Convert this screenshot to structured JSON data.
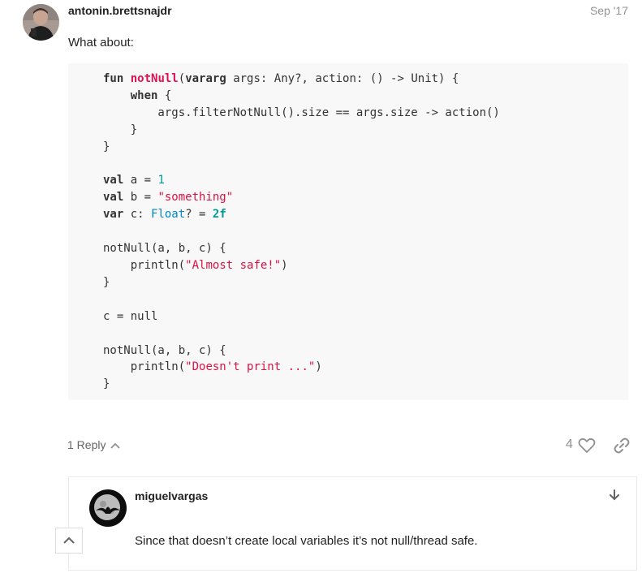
{
  "post": {
    "username": "antonin.brettsnajdr",
    "date": "Sep '17",
    "text": "What about:",
    "code_lines": [
      [
        {
          "t": "fun",
          "c": "kw"
        },
        {
          "t": " "
        },
        {
          "t": "notNull",
          "c": "fn"
        },
        {
          "t": "("
        },
        {
          "t": "vararg",
          "c": "kw"
        },
        {
          "t": " args: Any?, action: () -> Unit) {"
        }
      ],
      [
        {
          "t": "    "
        },
        {
          "t": "when",
          "c": "kw"
        },
        {
          "t": " {"
        }
      ],
      [
        {
          "t": "        args.filterNotNull().size == args.size -> action()"
        }
      ],
      [
        {
          "t": "    }"
        }
      ],
      [
        {
          "t": "}"
        }
      ],
      [
        {
          "t": ""
        }
      ],
      [
        {
          "t": "val",
          "c": "kw"
        },
        {
          "t": " a = "
        },
        {
          "t": "1",
          "c": "num"
        }
      ],
      [
        {
          "t": "val",
          "c": "kw"
        },
        {
          "t": " b = "
        },
        {
          "t": "\"something\"",
          "c": "str"
        }
      ],
      [
        {
          "t": "var",
          "c": "kw"
        },
        {
          "t": " c: "
        },
        {
          "t": "Float",
          "c": "ty"
        },
        {
          "t": "? = "
        },
        {
          "t": "2f",
          "c": "num-b"
        }
      ],
      [
        {
          "t": ""
        }
      ],
      [
        {
          "t": "notNull(a, b, c) {"
        }
      ],
      [
        {
          "t": "    println("
        },
        {
          "t": "\"Almost safe!\"",
          "c": "str"
        },
        {
          "t": ")"
        }
      ],
      [
        {
          "t": "}"
        }
      ],
      [
        {
          "t": ""
        }
      ],
      [
        {
          "t": "c = null"
        }
      ],
      [
        {
          "t": ""
        }
      ],
      [
        {
          "t": "notNull(a, b, c) {"
        }
      ],
      [
        {
          "t": "    println("
        },
        {
          "t": "\"Doesn't print ...\"",
          "c": "str"
        },
        {
          "t": ")"
        }
      ],
      [
        {
          "t": "}"
        }
      ]
    ],
    "replies_label": "1 Reply",
    "like_count": "4"
  },
  "reply": {
    "username": "miguelvargas",
    "text": "Since that doesn’t create local variables it’s not null/thread safe."
  },
  "icons": {
    "replies_toggle": "chevron-up-icon",
    "like": "heart-icon",
    "share": "link-icon",
    "jump_to_post": "arrow-down-icon",
    "scroll_top": "chevron-up-icon"
  },
  "colors": {
    "code_background": "#f8f8f8",
    "keyword_red": "#e0104f",
    "string_red": "#dd1144",
    "number_teal": "#009999",
    "type_blue": "#0088cc",
    "muted_text": "#919191"
  }
}
